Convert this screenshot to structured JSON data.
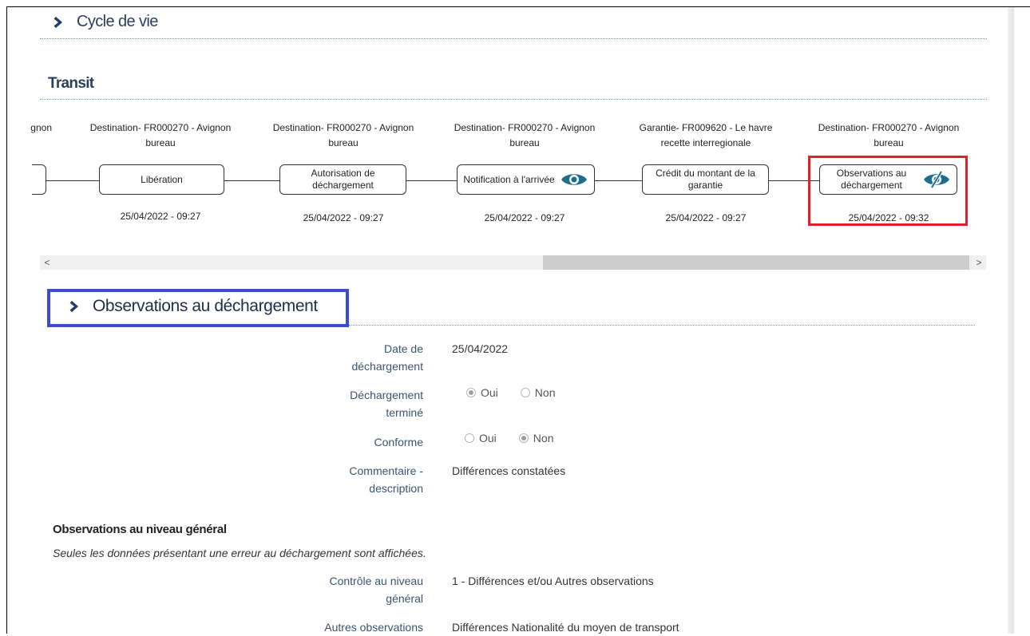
{
  "cycle_section": {
    "title": "Cycle de vie",
    "icon": "chevron-right-icon"
  },
  "transit": {
    "title": "Transit",
    "steps": [
      {
        "place": "gnon",
        "label": "",
        "date": ""
      },
      {
        "place": "Destination- FR000270 - Avignon bureau",
        "label": "Libération",
        "date": "25/04/2022 - 09:27",
        "icon": ""
      },
      {
        "place": "Destination- FR000270 - Avignon bureau",
        "label": "Autorisation de déchargement",
        "date": "25/04/2022 - 09:27",
        "icon": ""
      },
      {
        "place": "Destination- FR000270 - Avignon bureau",
        "label": "Notification à l'arrivée",
        "date": "25/04/2022 - 09:27",
        "icon": "eye-icon"
      },
      {
        "place": "Garantie- FR009620 - Le havre recette interregionale",
        "label": "Crédit du montant de la garantie",
        "date": "25/04/2022 - 09:27",
        "icon": ""
      },
      {
        "place": "Destination- FR000270 - Avignon bureau",
        "label": "Observations au déchargement",
        "date": "25/04/2022 - 09:32",
        "icon": "eye-slash-icon"
      }
    ],
    "scroll": {
      "left": "<",
      "right": ">"
    }
  },
  "observations": {
    "title": "Observations au déchargement",
    "fields": {
      "date": {
        "label": "Date de déchargement",
        "value": "25/04/2022"
      },
      "termine": {
        "label": "Déchargement terminé",
        "options": [
          "Oui",
          "Non"
        ],
        "selected": "Oui"
      },
      "conforme": {
        "label": "Conforme",
        "options": [
          "Oui",
          "Non"
        ],
        "selected": "Non"
      },
      "commentaire": {
        "label": "Commentaire - description",
        "value": "Différences constatées"
      }
    },
    "general": {
      "heading": "Observations au niveau général",
      "note": "Seules les données présentant une erreur au déchargement sont affichées.",
      "controle": {
        "label": "Contrôle au niveau général",
        "value": "1 - Différences et/ou Autres observations"
      },
      "autres": {
        "label": "Autres observations",
        "value": "Différences Nationalité du moyen de transport"
      }
    }
  },
  "colors": {
    "heading": "#2b3f5c",
    "label": "#3a5470",
    "eye_icon": "#1d6d8c",
    "red_highlight": "#e21f2c",
    "blue_highlight": "#3f4bd2"
  }
}
